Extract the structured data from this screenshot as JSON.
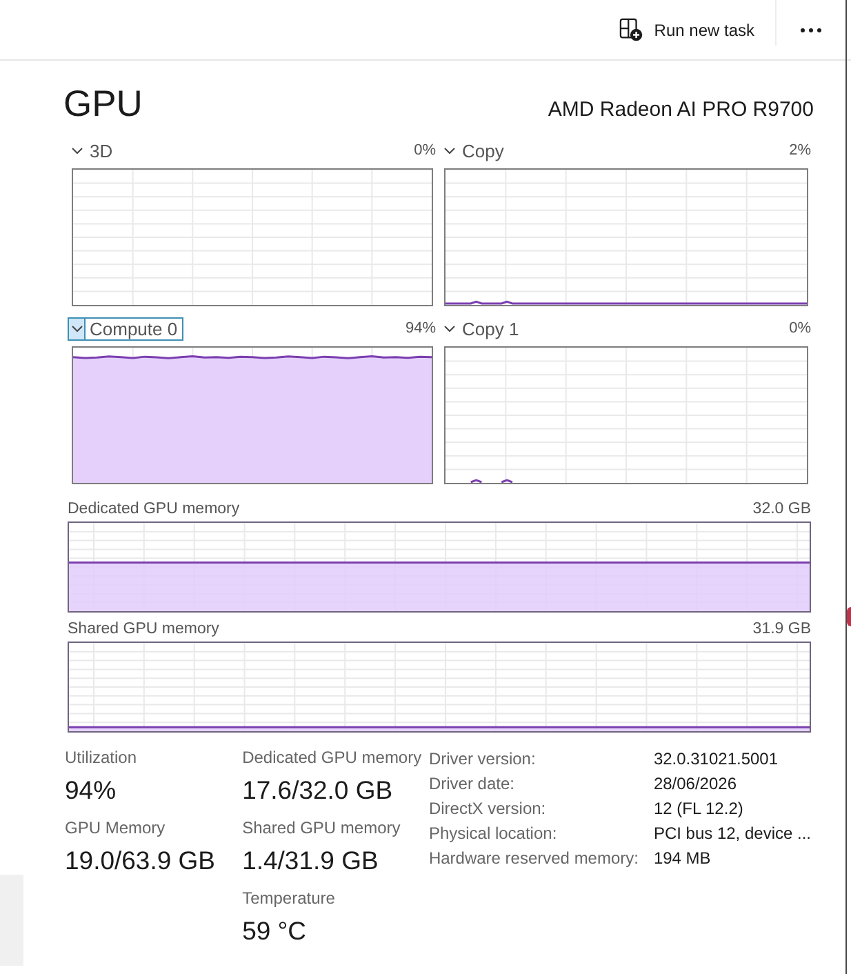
{
  "toolbar": {
    "run_task": {
      "label": "Run new task"
    }
  },
  "header": {
    "title": "GPU",
    "device": "AMD Radeon AI PRO R9700"
  },
  "engines": [
    {
      "label": "3D",
      "value": "0%",
      "selected": false
    },
    {
      "label": "Copy",
      "value": "2%",
      "selected": false
    },
    {
      "label": "Compute 0",
      "value": "94%",
      "selected": true
    },
    {
      "label": "Copy 1",
      "value": "0%",
      "selected": false
    }
  ],
  "memory_graphs": [
    {
      "label": "Dedicated GPU memory",
      "value": "32.0 GB"
    },
    {
      "label": "Shared GPU memory",
      "value": "31.9 GB"
    }
  ],
  "stat_columns": [
    {
      "items": [
        {
          "label": "Utilization",
          "value": "94%"
        },
        {
          "label": "GPU Memory",
          "value": "19.0/63.9 GB"
        }
      ]
    },
    {
      "items": [
        {
          "label": "Dedicated GPU memory",
          "value": "17.6/32.0 GB"
        },
        {
          "label": "Shared GPU memory",
          "value": "1.4/31.9 GB"
        },
        {
          "label": "Temperature",
          "value": "59 °C"
        }
      ]
    }
  ],
  "details": [
    {
      "label": "Driver version:",
      "value": "32.0.31021.5001"
    },
    {
      "label": "Driver date:",
      "value": "28/06/2026"
    },
    {
      "label": "DirectX version:",
      "value": "12 (FL 12.2)"
    },
    {
      "label": "Physical location:",
      "value": "PCI bus 12, device ..."
    },
    {
      "label": "Hardware reserved memory:",
      "value": "194 MB"
    }
  ]
}
